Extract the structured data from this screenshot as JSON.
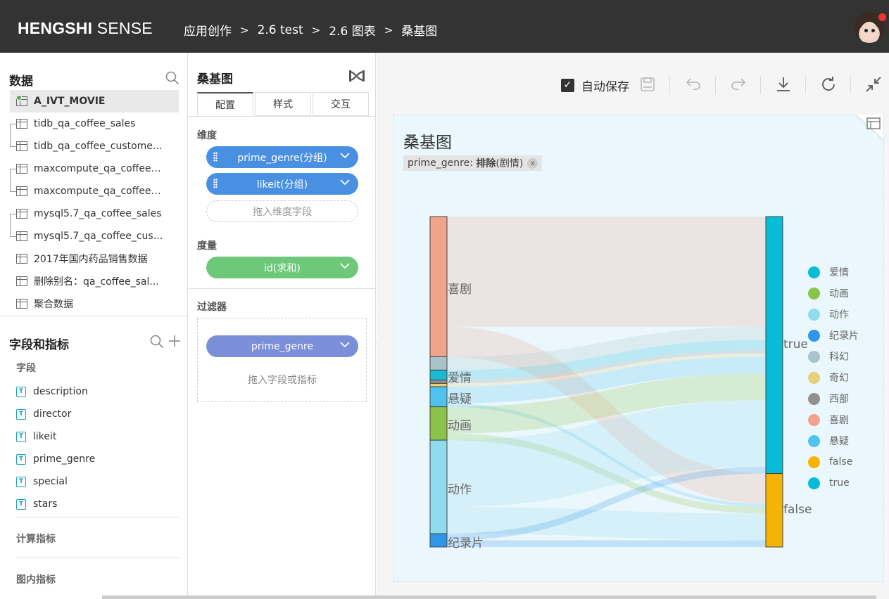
{
  "header": {
    "brand_bold": "HENGSHI",
    "brand_light": "SENSE",
    "breadcrumb": [
      "应用创作",
      "2.6 test",
      "2.6 图表",
      "桑基图"
    ],
    "separator": ">"
  },
  "data_panel": {
    "title": "数据",
    "datasets": [
      {
        "label": "A_IVT_MOVIE",
        "active": true
      },
      {
        "label": "tidb_qa_coffee_sales"
      },
      {
        "label": "tidb_qa_coffee_custome..."
      },
      {
        "label": "maxcompute_qa_coffee_..."
      },
      {
        "label": "maxcompute_qa_coffee_..."
      },
      {
        "label": "mysql5.7_qa_coffee_sales"
      },
      {
        "label": "mysql5.7_qa_coffee_cust..."
      },
      {
        "label": "2017年国内药品销售数据"
      },
      {
        "label": "删除别名：qa_coffee_sal..."
      },
      {
        "label": "聚合数据"
      }
    ]
  },
  "fields_panel": {
    "title": "字段和指标",
    "fields_label": "字段",
    "field_type_icon": "T",
    "fields": [
      "description",
      "director",
      "likeit",
      "prime_genre",
      "special",
      "stars"
    ],
    "calc_metrics_label": "计算指标",
    "chart_metrics_label": "图内指标"
  },
  "config_panel": {
    "title": "桑基图",
    "tabs": [
      "配置",
      "样式",
      "交互"
    ],
    "dimension_label": "维度",
    "dimensions": [
      "prime_genre(分组)",
      "likeit(分组)"
    ],
    "dimension_drop_placeholder": "拖入维度字段",
    "measure_label": "度量",
    "measures": [
      "id(求和)"
    ],
    "filter_label": "过滤器",
    "filters": [
      "prime_genre"
    ],
    "filter_drop_placeholder": "拖入字段或指标"
  },
  "toolbar": {
    "autosave_label": "自动保存",
    "autosave_checked": true
  },
  "chart": {
    "title": "桑基图",
    "filter_chip_field": "prime_genre:",
    "filter_chip_op": "排除",
    "filter_chip_value": "(剧情)",
    "filter_chip_close": "x"
  },
  "colors": {
    "topbar": "#333333",
    "pill_blue": "#4a90e2",
    "pill_green": "#6dc87a",
    "pill_filter": "#7b8fd8",
    "chart_bg": "#eaf7fc"
  },
  "chart_data": {
    "type": "sankey",
    "title": "桑基图",
    "source_nodes": [
      {
        "name": "喜剧",
        "value": 42,
        "color": "#f0a48c",
        "label": "喜剧"
      },
      {
        "name": "科幻",
        "value": 4,
        "color": "#a8c4c9",
        "label": ""
      },
      {
        "name": "爱情",
        "value": 3,
        "color": "#19b9d4",
        "label": "爱情"
      },
      {
        "name": "西部",
        "value": 1,
        "color": "#909090",
        "label": ""
      },
      {
        "name": "奇幻",
        "value": 1,
        "color": "#e6d07a",
        "label": ""
      },
      {
        "name": "悬疑",
        "value": 6,
        "color": "#4ec3f0",
        "label": "悬疑"
      },
      {
        "name": "动画",
        "value": 10,
        "color": "#8bc34a",
        "label": "动画"
      },
      {
        "name": "动作",
        "value": 28,
        "color": "#8fdcef",
        "label": "动作"
      },
      {
        "name": "纪录片",
        "value": 4,
        "color": "#2f96e8",
        "label": "纪录片"
      }
    ],
    "target_nodes": [
      {
        "name": "true",
        "value": 77,
        "color": "#06bcd6",
        "label": "true"
      },
      {
        "name": "false",
        "value": 22,
        "color": "#f6b400",
        "label": "false"
      }
    ],
    "links": [
      {
        "source": "喜剧",
        "target": "true",
        "value": 33
      },
      {
        "source": "喜剧",
        "target": "false",
        "value": 9
      },
      {
        "source": "科幻",
        "target": "true",
        "value": 4
      },
      {
        "source": "爱情",
        "target": "true",
        "value": 3
      },
      {
        "source": "西部",
        "target": "true",
        "value": 1
      },
      {
        "source": "奇幻",
        "target": "true",
        "value": 1
      },
      {
        "source": "悬疑",
        "target": "true",
        "value": 5
      },
      {
        "source": "悬疑",
        "target": "false",
        "value": 1
      },
      {
        "source": "动画",
        "target": "true",
        "value": 8
      },
      {
        "source": "动画",
        "target": "false",
        "value": 2
      },
      {
        "source": "动作",
        "target": "true",
        "value": 20
      },
      {
        "source": "动作",
        "target": "false",
        "value": 8
      },
      {
        "source": "纪录片",
        "target": "true",
        "value": 2
      },
      {
        "source": "纪录片",
        "target": "false",
        "value": 2
      }
    ],
    "legend": [
      {
        "name": "爱情",
        "color": "#06bcd6"
      },
      {
        "name": "动画",
        "color": "#8bc34a"
      },
      {
        "name": "动作",
        "color": "#8fdcef"
      },
      {
        "name": "纪录片",
        "color": "#2f96e8"
      },
      {
        "name": "科幻",
        "color": "#a8c4c9"
      },
      {
        "name": "奇幻",
        "color": "#e6d07a"
      },
      {
        "name": "西部",
        "color": "#909090"
      },
      {
        "name": "喜剧",
        "color": "#f0a48c"
      },
      {
        "name": "悬疑",
        "color": "#4ec3f0"
      },
      {
        "name": "false",
        "color": "#f6b400"
      },
      {
        "name": "true",
        "color": "#06bcd6"
      }
    ],
    "legend_position": "right"
  }
}
